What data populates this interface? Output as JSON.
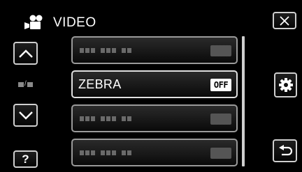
{
  "header": {
    "title": "VIDEO",
    "icon": "movie-camera-icon"
  },
  "nav": {
    "close_icon": "close-icon",
    "up_icon": "chevron-up-icon",
    "down_icon": "chevron-down-icon",
    "help_label": "?",
    "settings_icon": "gear-icon",
    "back_icon": "return-icon"
  },
  "menu": {
    "items": [
      {
        "label": "",
        "value": ""
      },
      {
        "label": "ZEBRA",
        "value": "OFF",
        "selected": true
      },
      {
        "label": "",
        "value": ""
      },
      {
        "label": "",
        "value": ""
      }
    ]
  },
  "colors": {
    "background": "#000000",
    "border": "#cfcfcf",
    "value_badge": "#ffffff"
  }
}
